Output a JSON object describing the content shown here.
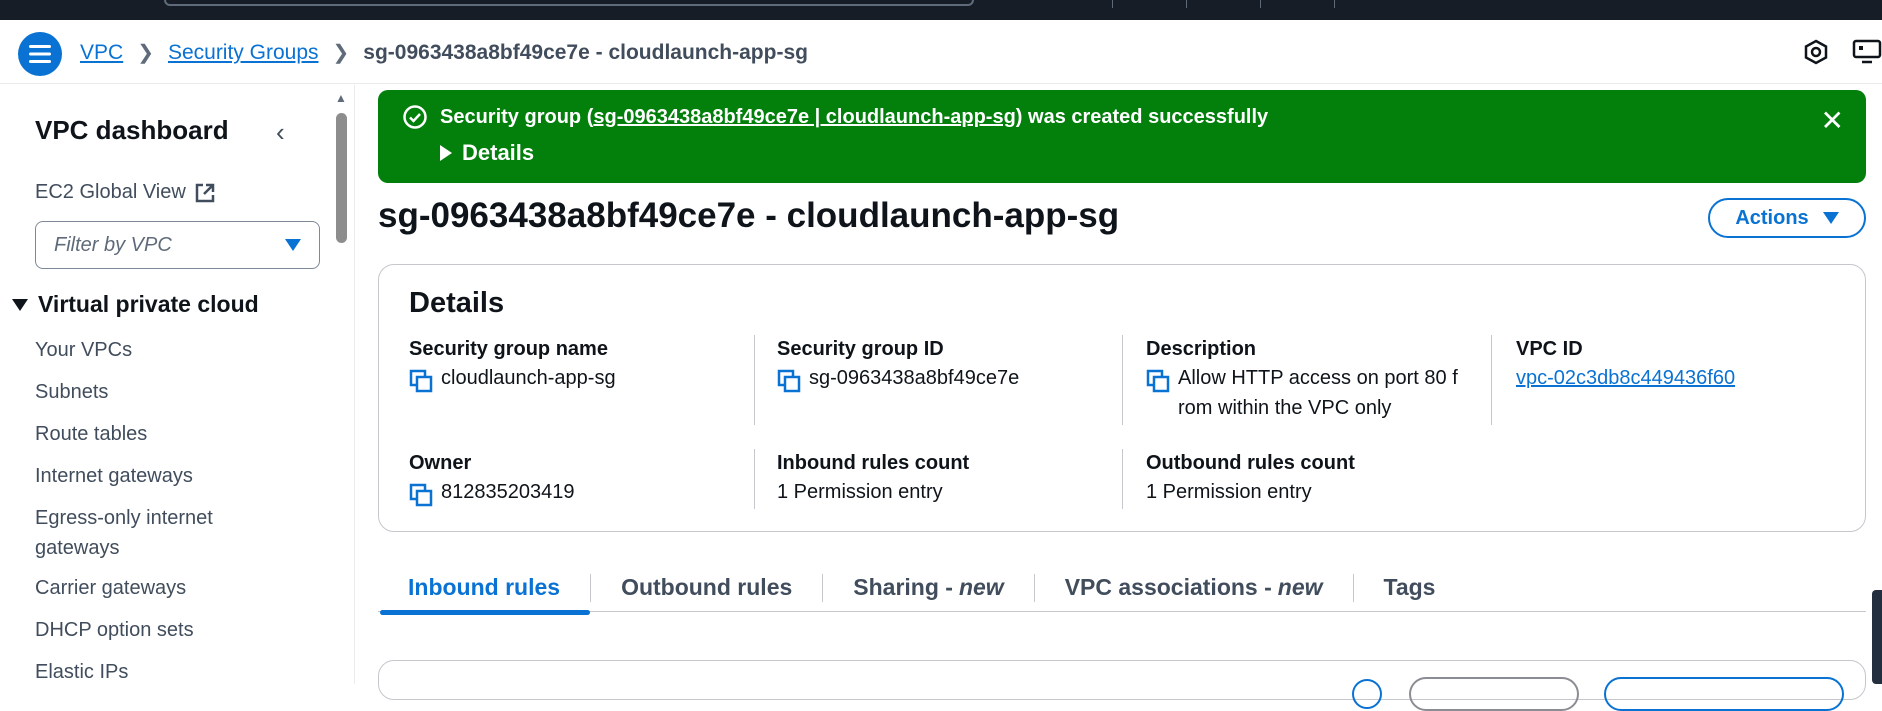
{
  "breadcrumb": {
    "items": [
      "VPC",
      "Security Groups"
    ],
    "current": "sg-0963438a8bf49ce7e - cloudlaunch-app-sg"
  },
  "sidebar": {
    "title": "VPC dashboard",
    "ec2_global_view": "EC2 Global View",
    "filter_placeholder": "Filter by VPC",
    "section": "Virtual private cloud",
    "items": [
      "Your VPCs",
      "Subnets",
      "Route tables",
      "Internet gateways",
      "Egress-only internet gateways",
      "Carrier gateways",
      "DHCP option sets",
      "Elastic IPs"
    ]
  },
  "flash": {
    "prefix": "Security group (",
    "link": "sg-0963438a8bf49ce7e | cloudlaunch-app-sg",
    "suffix": ") was created successfully",
    "details_label": "Details",
    "color": "#037f0c"
  },
  "page": {
    "title": "sg-0963438a8bf49ce7e - cloudlaunch-app-sg",
    "actions_label": "Actions"
  },
  "details": {
    "heading": "Details",
    "fields": {
      "sg_name": {
        "label": "Security group name",
        "value": "cloudlaunch-app-sg"
      },
      "sg_id": {
        "label": "Security group ID",
        "value": "sg-0963438a8bf49ce7e"
      },
      "description": {
        "label": "Description",
        "value": "Allow HTTP access on port 80 from within the VPC only"
      },
      "vpc_id": {
        "label": "VPC ID",
        "value": "vpc-02c3db8c449436f60"
      },
      "owner": {
        "label": "Owner",
        "value": "812835203419"
      },
      "inbound_count": {
        "label": "Inbound rules count",
        "value": "1 Permission entry"
      },
      "outbound_count": {
        "label": "Outbound rules count",
        "value": "1 Permission entry"
      }
    }
  },
  "tabs": [
    {
      "label": "Inbound rules",
      "suffix": ""
    },
    {
      "label": "Outbound rules",
      "suffix": ""
    },
    {
      "label": "Sharing -",
      "suffix": "new"
    },
    {
      "label": "VPC associations -",
      "suffix": "new"
    },
    {
      "label": "Tags",
      "suffix": ""
    }
  ],
  "colors": {
    "accent": "#0972d3",
    "success": "#037f0c",
    "text": "#0f141a",
    "topbar": "#161d26"
  }
}
